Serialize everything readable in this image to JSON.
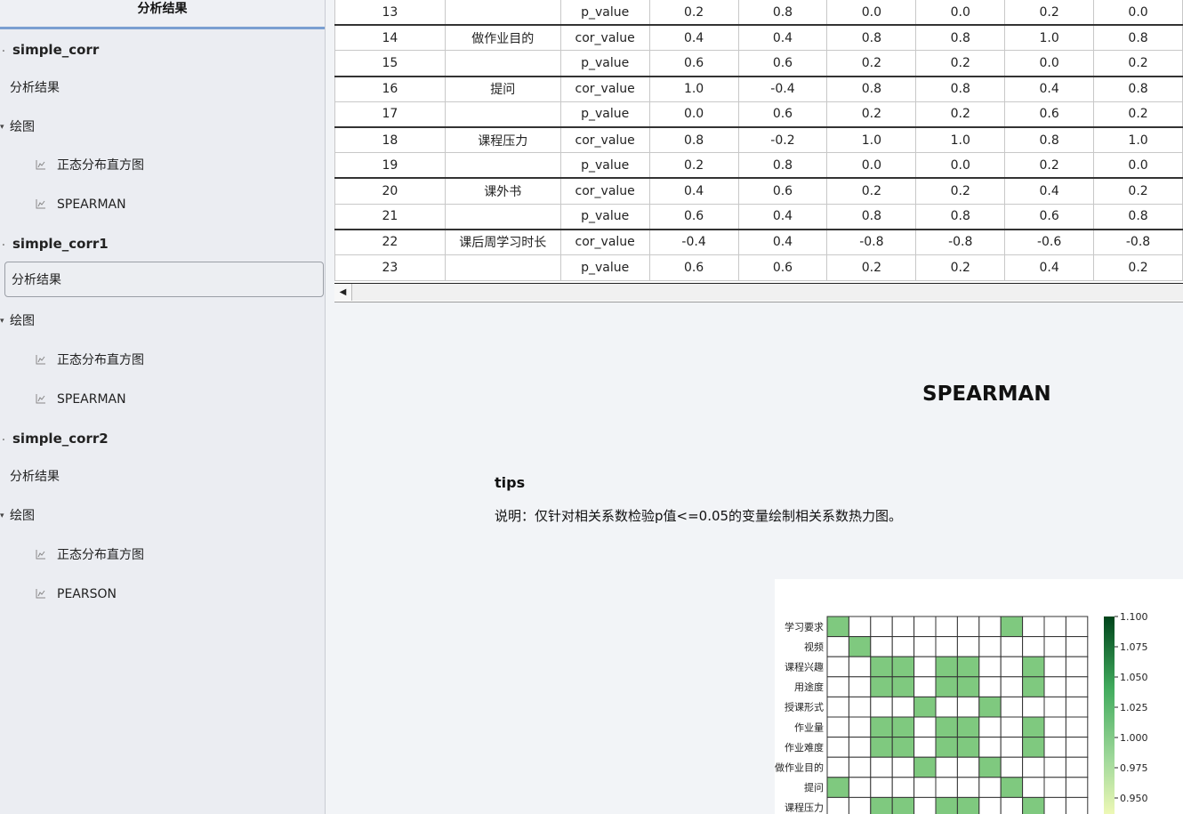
{
  "sidebar": {
    "header": "分析结果",
    "groups": [
      {
        "name": "simple_corr",
        "result": "分析结果",
        "draw": "绘图",
        "plots": [
          "正态分布直方图",
          "SPEARMAN"
        ]
      },
      {
        "name": "simple_corr1",
        "result": "分析结果",
        "draw": "绘图",
        "plots": [
          "正态分布直方图",
          "SPEARMAN"
        ]
      },
      {
        "name": "simple_corr2",
        "result": "分析结果",
        "draw": "绘图",
        "plots": [
          "正态分布直方图",
          "PEARSON"
        ]
      }
    ]
  },
  "table": {
    "rows": [
      {
        "idx": "13",
        "var": "",
        "stat": "p_value",
        "vals": [
          "0.2",
          "0.8",
          "0.0",
          "0.0",
          "0.2",
          "0.0"
        ]
      },
      {
        "idx": "14",
        "var": "做作业目的",
        "stat": "cor_value",
        "vals": [
          "0.4",
          "0.4",
          "0.8",
          "0.8",
          "1.0",
          "0.8"
        ]
      },
      {
        "idx": "15",
        "var": "",
        "stat": "p_value",
        "vals": [
          "0.6",
          "0.6",
          "0.2",
          "0.2",
          "0.0",
          "0.2"
        ]
      },
      {
        "idx": "16",
        "var": "提问",
        "stat": "cor_value",
        "vals": [
          "1.0",
          "-0.4",
          "0.8",
          "0.8",
          "0.4",
          "0.8"
        ]
      },
      {
        "idx": "17",
        "var": "",
        "stat": "p_value",
        "vals": [
          "0.0",
          "0.6",
          "0.2",
          "0.2",
          "0.6",
          "0.2"
        ]
      },
      {
        "idx": "18",
        "var": "课程压力",
        "stat": "cor_value",
        "vals": [
          "0.8",
          "-0.2",
          "1.0",
          "1.0",
          "0.8",
          "1.0"
        ]
      },
      {
        "idx": "19",
        "var": "",
        "stat": "p_value",
        "vals": [
          "0.2",
          "0.8",
          "0.0",
          "0.0",
          "0.2",
          "0.0"
        ]
      },
      {
        "idx": "20",
        "var": "课外书",
        "stat": "cor_value",
        "vals": [
          "0.4",
          "0.6",
          "0.2",
          "0.2",
          "0.4",
          "0.2"
        ]
      },
      {
        "idx": "21",
        "var": "",
        "stat": "p_value",
        "vals": [
          "0.6",
          "0.4",
          "0.8",
          "0.8",
          "0.6",
          "0.8"
        ]
      },
      {
        "idx": "22",
        "var": "课后周学习时长",
        "stat": "cor_value",
        "vals": [
          "-0.4",
          "0.4",
          "-0.8",
          "-0.8",
          "-0.6",
          "-0.8"
        ]
      },
      {
        "idx": "23",
        "var": "",
        "stat": "p_value",
        "vals": [
          "0.6",
          "0.6",
          "0.2",
          "0.2",
          "0.4",
          "0.2"
        ]
      }
    ]
  },
  "content": {
    "title": "SPEARMAN",
    "tips_label": "tips",
    "description": "说明：仅针对相关系数检验p值<=0.05的变量绘制相关系数热力图。"
  },
  "chart_data": {
    "type": "heatmap",
    "y_categories": [
      "学习要求",
      "视频",
      "课程兴趣",
      "用途度",
      "授课形式",
      "作业量",
      "作业难度",
      "做作业目的",
      "提问",
      "课程压力"
    ],
    "filled": [
      [
        1,
        0,
        0,
        0,
        0,
        0,
        0,
        0,
        1,
        0,
        0,
        0
      ],
      [
        0,
        1,
        0,
        0,
        0,
        0,
        0,
        0,
        0,
        0,
        0,
        0
      ],
      [
        0,
        0,
        1,
        1,
        0,
        1,
        1,
        0,
        0,
        1,
        0,
        0
      ],
      [
        0,
        0,
        1,
        1,
        0,
        1,
        1,
        0,
        0,
        1,
        0,
        0
      ],
      [
        0,
        0,
        0,
        0,
        1,
        0,
        0,
        1,
        0,
        0,
        0,
        0
      ],
      [
        0,
        0,
        1,
        1,
        0,
        1,
        1,
        0,
        0,
        1,
        0,
        0
      ],
      [
        0,
        0,
        1,
        1,
        0,
        1,
        1,
        0,
        0,
        1,
        0,
        0
      ],
      [
        0,
        0,
        0,
        0,
        1,
        0,
        0,
        1,
        0,
        0,
        0,
        0
      ],
      [
        1,
        0,
        0,
        0,
        0,
        0,
        0,
        0,
        1,
        0,
        0,
        0
      ],
      [
        0,
        0,
        1,
        1,
        0,
        1,
        1,
        0,
        0,
        1,
        0,
        0
      ]
    ],
    "colorbar_ticks": [
      "1.100",
      "1.075",
      "1.050",
      "1.025",
      "1.000",
      "0.975",
      "0.950"
    ],
    "colors": {
      "fill": "#7fc97f",
      "empty": "#ffffff",
      "grid": "#333333"
    }
  }
}
